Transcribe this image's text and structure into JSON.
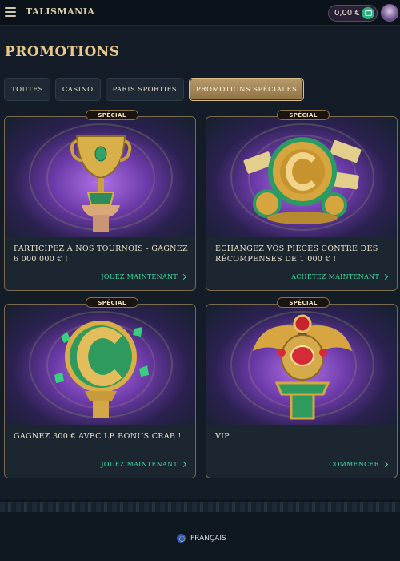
{
  "header": {
    "logo_text": "TALISMANIA",
    "balance": "0,00 €"
  },
  "page": {
    "title": "PROMOTIONS"
  },
  "tabs": [
    {
      "label": "TOUTES",
      "active": false
    },
    {
      "label": "CASINO",
      "active": false
    },
    {
      "label": "PARIS SPORTIFS",
      "active": false
    },
    {
      "label": "PROMOTIONS SPÉCIALES",
      "active": true
    }
  ],
  "cards": [
    {
      "badge": "SPÉCIAL",
      "title": "PARTICIPEZ À NOS TOURNOIS - GAGNEZ 6 000 000 € !",
      "cta": "JOUEZ MAINTENANT",
      "art": "golden-trophy"
    },
    {
      "badge": "SPÉCIAL",
      "title": "ECHANGEZ VOS PIÈCES CONTRE DES RÉCOMPENSES DE 1 000 € !",
      "cta": "ACHETEZ MAINTENANT",
      "art": "coins-and-free-bet-tickets"
    },
    {
      "badge": "SPÉCIAL",
      "title": "GAGNEZ 300 € AVEC LE BONUS CRAB !",
      "cta": "JOUEZ MAINTENANT",
      "art": "crab-logo-emeralds"
    },
    {
      "badge": "SPÉCIAL",
      "title": "VIP",
      "cta": "COMMENCER",
      "art": "golden-scarab"
    }
  ],
  "footer": {
    "language": "FRANÇAIS"
  },
  "colors": {
    "accent_green": "#3fe0a0",
    "gold": "#e7c88a",
    "active_tab": "#b79a6a",
    "background": "#141d27"
  }
}
